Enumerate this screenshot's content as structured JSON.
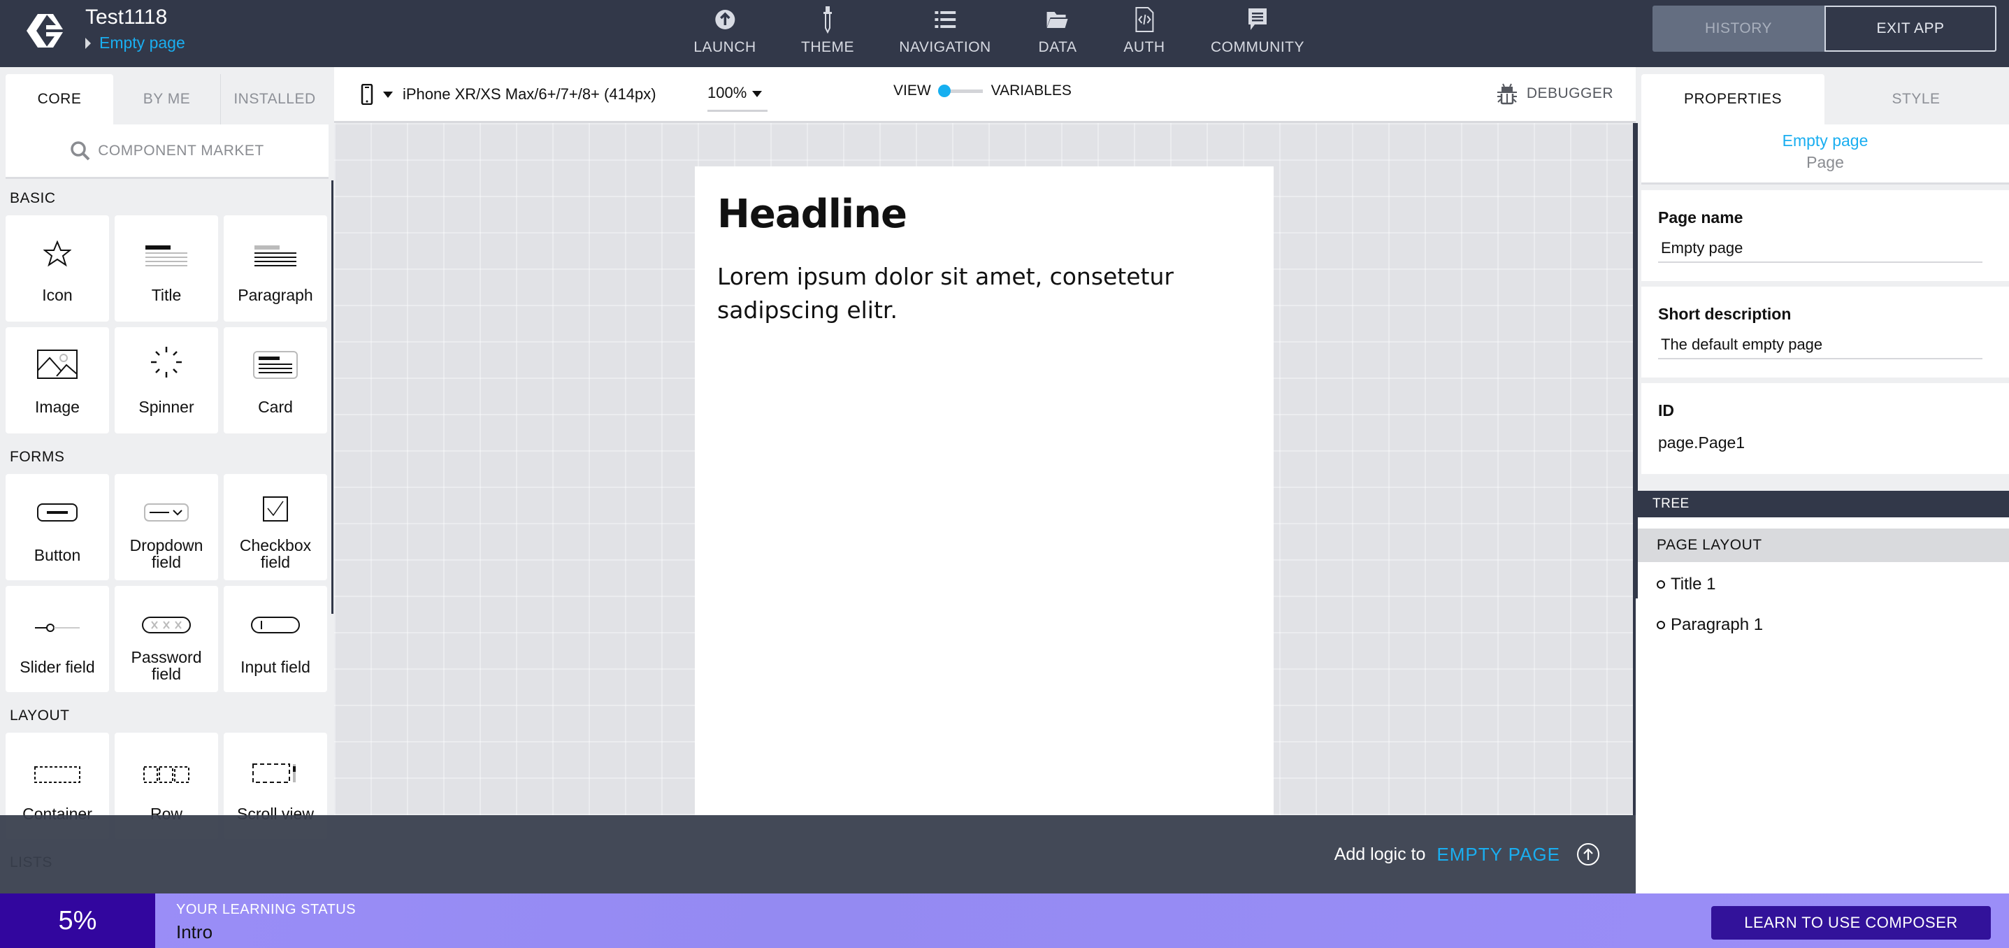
{
  "header": {
    "app_title": "Test1118",
    "breadcrumb": "Empty page",
    "nav": [
      {
        "label": "LAUNCH",
        "icon": "launch-icon"
      },
      {
        "label": "THEME",
        "icon": "eyedropper-icon"
      },
      {
        "label": "NAVIGATION",
        "icon": "list-icon"
      },
      {
        "label": "DATA",
        "icon": "folder-icon"
      },
      {
        "label": "AUTH",
        "icon": "code-file-icon"
      },
      {
        "label": "COMMUNITY",
        "icon": "chat-icon"
      }
    ],
    "history_label": "HISTORY",
    "exit_label": "EXIT APP"
  },
  "left_panel": {
    "tabs": [
      "CORE",
      "BY ME",
      "INSTALLED"
    ],
    "active_tab": "CORE",
    "market_label": "COMPONENT MARKET",
    "sections": [
      {
        "title": "BASIC",
        "items": [
          "Icon",
          "Title",
          "Paragraph",
          "Image",
          "Spinner",
          "Card"
        ]
      },
      {
        "title": "FORMS",
        "items": [
          "Button",
          "Dropdown field",
          "Checkbox field",
          "Slider field",
          "Password field",
          "Input field"
        ]
      },
      {
        "title": "LAYOUT",
        "items": [
          "Container",
          "Row",
          "Scroll view"
        ]
      },
      {
        "title": "LISTS",
        "items": []
      }
    ]
  },
  "canvas": {
    "device": "iPhone XR/XS Max/6+/7+/8+ (414px)",
    "zoom": "100%",
    "toggle_left": "VIEW",
    "toggle_right": "VARIABLES",
    "debugger_label": "DEBUGGER",
    "page": {
      "headline": "Headline",
      "paragraph": "Lorem ipsum dolor sit amet, consetetur sadipscing elitr."
    }
  },
  "logic_bar": {
    "text": "Add logic to",
    "target": "EMPTY PAGE"
  },
  "right_panel": {
    "tabs": [
      "PROPERTIES",
      "STYLE"
    ],
    "active_tab": "PROPERTIES",
    "selected_name": "Empty page",
    "selected_type": "Page",
    "fields": {
      "page_name_label": "Page name",
      "page_name_value": "Empty page",
      "short_desc_label": "Short description",
      "short_desc_value": "The default empty page",
      "id_label": "ID",
      "id_value": "page.Page1"
    },
    "tree": {
      "header": "TREE",
      "section": "PAGE LAYOUT",
      "items": [
        "Title 1",
        "Paragraph 1"
      ]
    }
  },
  "learning_bar": {
    "percent": "5%",
    "label": "YOUR LEARNING STATUS",
    "value": "Intro",
    "button": "LEARN TO USE COMPOSER"
  },
  "colors": {
    "header_bg": "#323849",
    "accent": "#1aaef0",
    "learning_dark": "#32069e",
    "learning_light": "#9b8ef8"
  }
}
